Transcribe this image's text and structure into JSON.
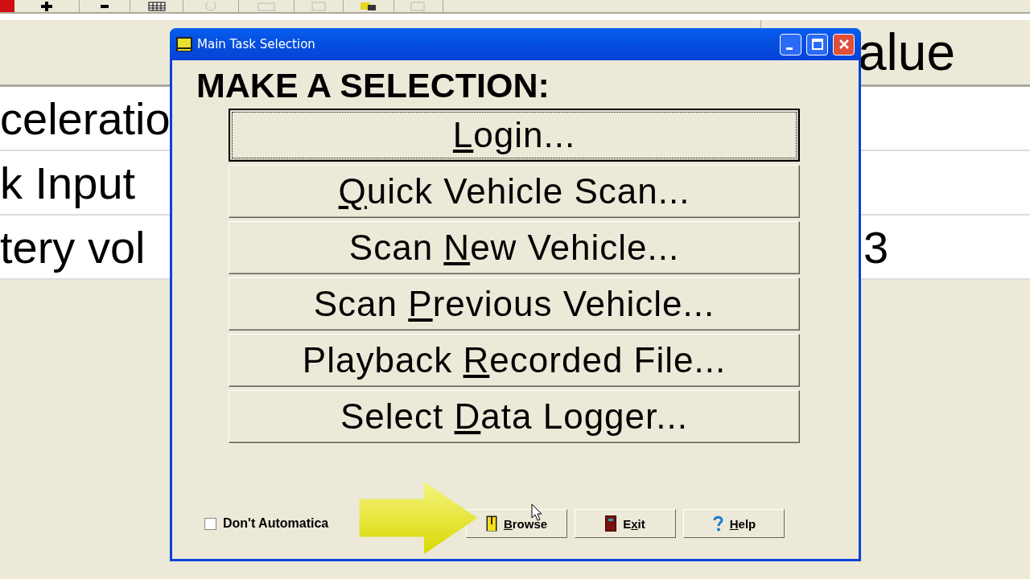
{
  "background_table": {
    "header": {
      "column_2": "alue"
    },
    "rows": [
      {
        "column_1": "celeratio"
      },
      {
        "column_1": "k Input"
      },
      {
        "column_1": "tery vol",
        "column_2": "3"
      }
    ]
  },
  "dialog": {
    "title": "Main Task Selection",
    "heading": "MAKE A SELECTION:",
    "tasks": [
      {
        "label_parts": {
          "key": "L",
          "after": "ogin..."
        },
        "focused": true
      },
      {
        "label_parts": {
          "key": "Q",
          "after": "uick Vehicle Scan..."
        },
        "focused": false
      },
      {
        "label_parts": {
          "before": "Scan ",
          "key": "N",
          "after": "ew Vehicle..."
        },
        "focused": false
      },
      {
        "label_parts": {
          "before": "Scan ",
          "key": "P",
          "after": "revious Vehicle..."
        },
        "focused": false
      },
      {
        "label_parts": {
          "before": "Playback ",
          "key": "R",
          "after": "ecorded File..."
        },
        "focused": false
      },
      {
        "label_parts": {
          "before": "Select ",
          "key": "D",
          "after": "ata Logger..."
        },
        "focused": false
      }
    ],
    "checkbox": {
      "label": "Don't Automatica",
      "checked": false
    },
    "buttons": [
      {
        "kind": "browse",
        "label_parts": {
          "key": "B",
          "after": "rowse"
        }
      },
      {
        "kind": "exit",
        "label_parts": {
          "before": "E",
          "key": "x",
          "after": "it"
        }
      },
      {
        "kind": "help",
        "label_parts": {
          "key": "H",
          "after": "elp"
        }
      }
    ]
  }
}
